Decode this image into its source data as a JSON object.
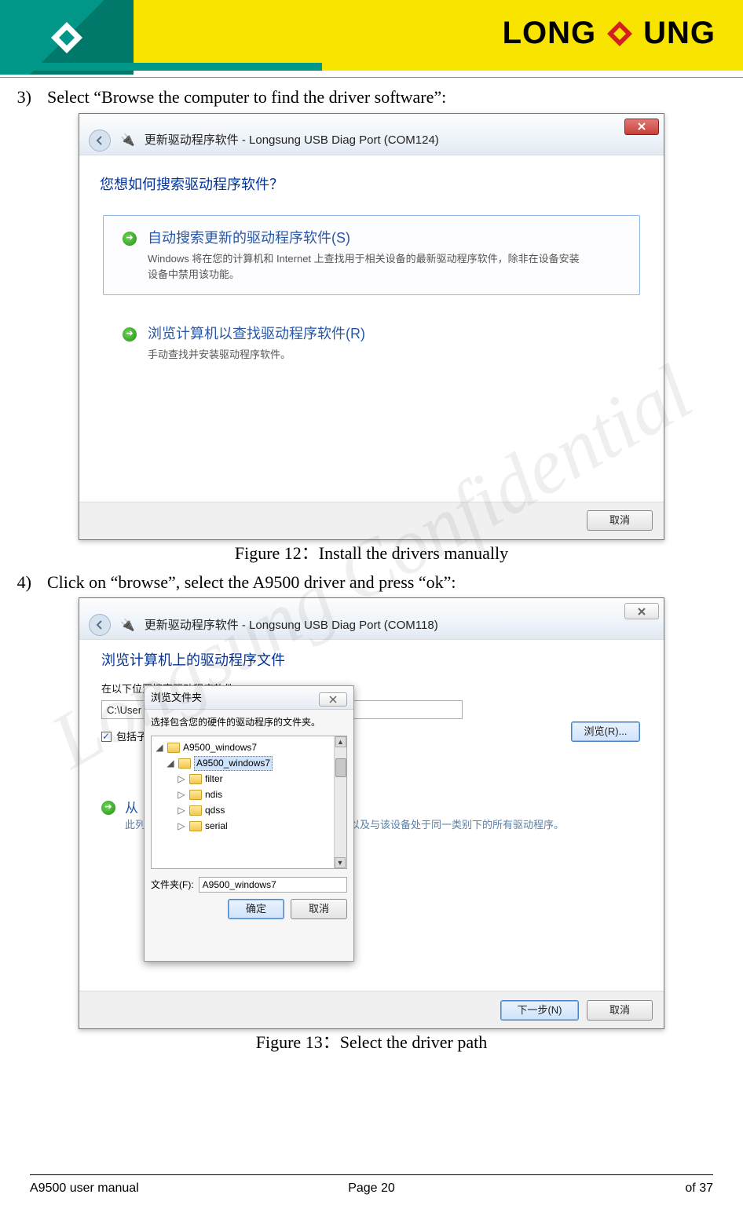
{
  "brand": {
    "name_left": "LONG",
    "name_right": "UNG"
  },
  "steps": {
    "s3_num": "3)",
    "s3_text": "Select “Browse the computer to find the driver software”:",
    "s4_num": "4)",
    "s4_text": "Click on “browse”, select the A9500 driver and press “ok”:"
  },
  "captions": {
    "fig12": "Figure 12：Install the drivers manually",
    "fig13": "Figure 13：Select the driver path"
  },
  "dialog1": {
    "title": "更新驱动程序软件 - Longsung USB Diag Port (COM124)",
    "question": "您想如何搜索驱动程序软件？",
    "opt1_title": "自动搜索更新的驱动程序软件(S)",
    "opt1_desc": "Windows 将在您的计算机和 Internet 上查找用于相关设备的最新驱动程序软件，除非在设备安装设备中禁用该功能。",
    "opt2_title": "浏览计算机以查找驱动程序软件(R)",
    "opt2_desc": "手动查找并安装驱动程序软件。",
    "cancel": "取消"
  },
  "dialog2": {
    "title": "更新驱动程序软件 - Longsung USB Diag Port (COM118)",
    "section_title": "浏览计算机上的驱动程序文件",
    "path_label": "在以下位置搜索驱动程序软件:",
    "path_value": "C:\\User",
    "browse": "浏览(R)...",
    "include_sub": "包括子文件夹",
    "assoc_prefix": "从",
    "assoc_desc": "此列表将显示与该设备兼容的已安装的驱动程序，以及与该设备处于同一类别下的所有驱动程序。",
    "next": "下一步(N)",
    "cancel": "取消"
  },
  "browse_modal": {
    "title": "浏览文件夹",
    "instr": "选择包含您的硬件的驱动程序的文件夹。",
    "tree": {
      "n0": "A9500_windows7",
      "n1": "A9500_windows7",
      "n2": "filter",
      "n3": "ndis",
      "n4": "qdss",
      "n5": "serial"
    },
    "folder_label": "文件夹(F):",
    "folder_value": "A9500_windows7",
    "ok": "确定",
    "cancel": "取消"
  },
  "footer": {
    "left": "A9500 user manual",
    "mid": "Page 20",
    "right": "of 37"
  },
  "watermark": "Longsung Confidential"
}
